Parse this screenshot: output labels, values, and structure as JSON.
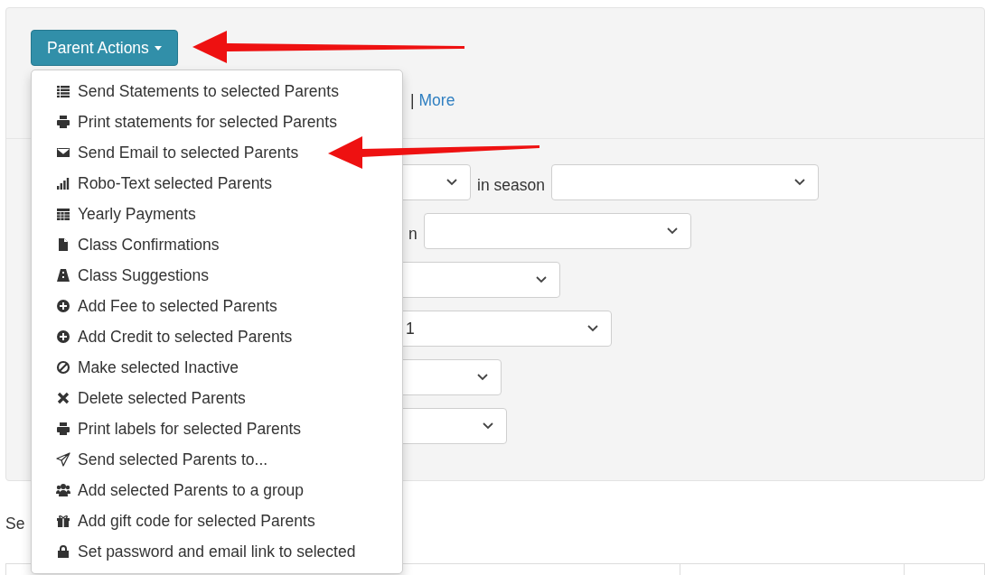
{
  "panel": {
    "parent_actions": {
      "label": "Parent Actions",
      "expanded": true,
      "items": [
        "Send Statements to selected Parents",
        "Print statements for selected Parents",
        "Send Email to selected Parents",
        "Robo-Text selected Parents",
        "Yearly Payments",
        "Class Confirmations",
        "Class Suggestions",
        "Add Fee to selected Parents",
        "Add Credit to selected Parents",
        "Make selected Inactive",
        "Delete selected Parents",
        "Print labels for selected Parents",
        "Send selected Parents to...",
        "Add selected Parents to a group",
        "Add gift code for selected Parents",
        "Set password and email link to selected"
      ]
    },
    "link_row": {
      "separator": "|",
      "link": "More"
    },
    "filter_rows": [
      [
        {
          "kind": "select"
        },
        {
          "kind": "label",
          "text": "in season"
        },
        {
          "kind": "select"
        }
      ],
      [
        {
          "kind": "label",
          "text": "n"
        },
        {
          "kind": "select"
        }
      ],
      [
        {
          "kind": "select"
        }
      ],
      [
        {
          "kind": "select",
          "value": "1"
        }
      ],
      [
        {
          "kind": "select"
        }
      ],
      [
        {
          "kind": "select"
        }
      ]
    ]
  },
  "search_label": "Se"
}
